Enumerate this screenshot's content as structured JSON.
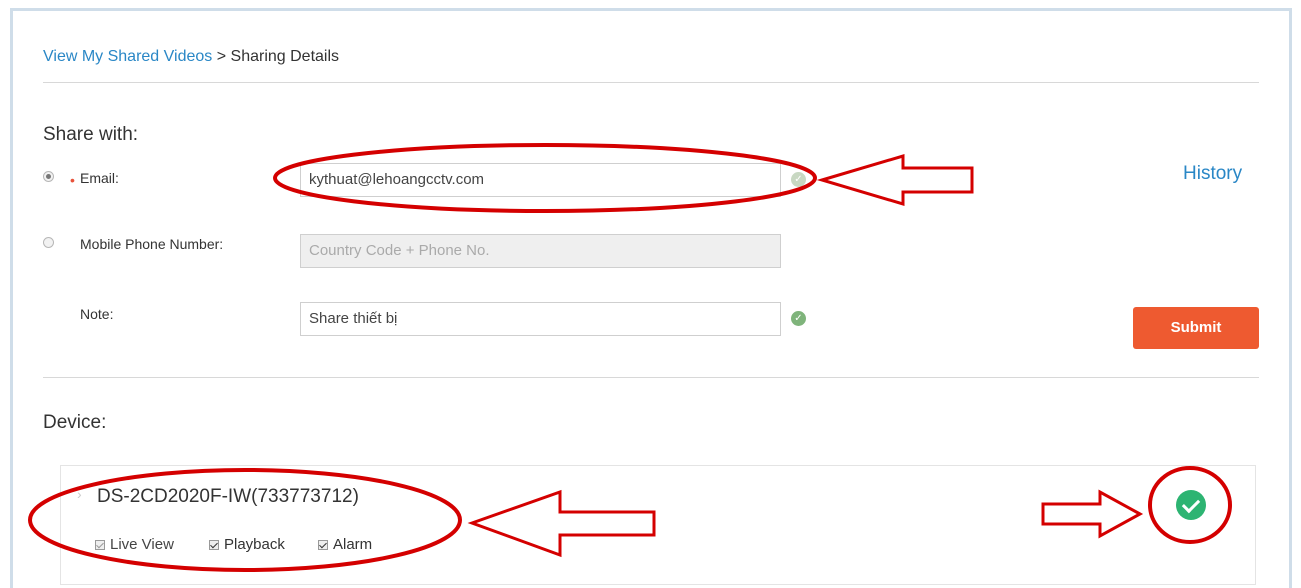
{
  "breadcrumb": {
    "link": "View My Shared Videos",
    "separator": " > ",
    "current": "Sharing Details"
  },
  "share": {
    "title": "Share with:",
    "email_required": "•",
    "email_label": "Email:",
    "email_value": "kythuat@lehoangcctv.com",
    "phone_label": "Mobile Phone Number:",
    "phone_placeholder": "Country Code + Phone No.",
    "note_label": "Note:",
    "note_value": "Share thiết bị",
    "history_label": "History",
    "submit_label": "Submit",
    "selected_option": "email"
  },
  "device": {
    "title": "Device:",
    "name": "DS-2CD2020F-IW(733773712)",
    "permissions": [
      {
        "label": "Live View",
        "checked": true
      },
      {
        "label": "Playback",
        "checked": true
      },
      {
        "label": "Alarm",
        "checked": true
      }
    ]
  },
  "colors": {
    "link": "#2a87c6",
    "submit": "#ee5a30",
    "success": "#2db472",
    "annotation": "#d40000"
  },
  "icons": {
    "ok": "check-circle-icon",
    "arrow": "left-arrow-annotation"
  }
}
